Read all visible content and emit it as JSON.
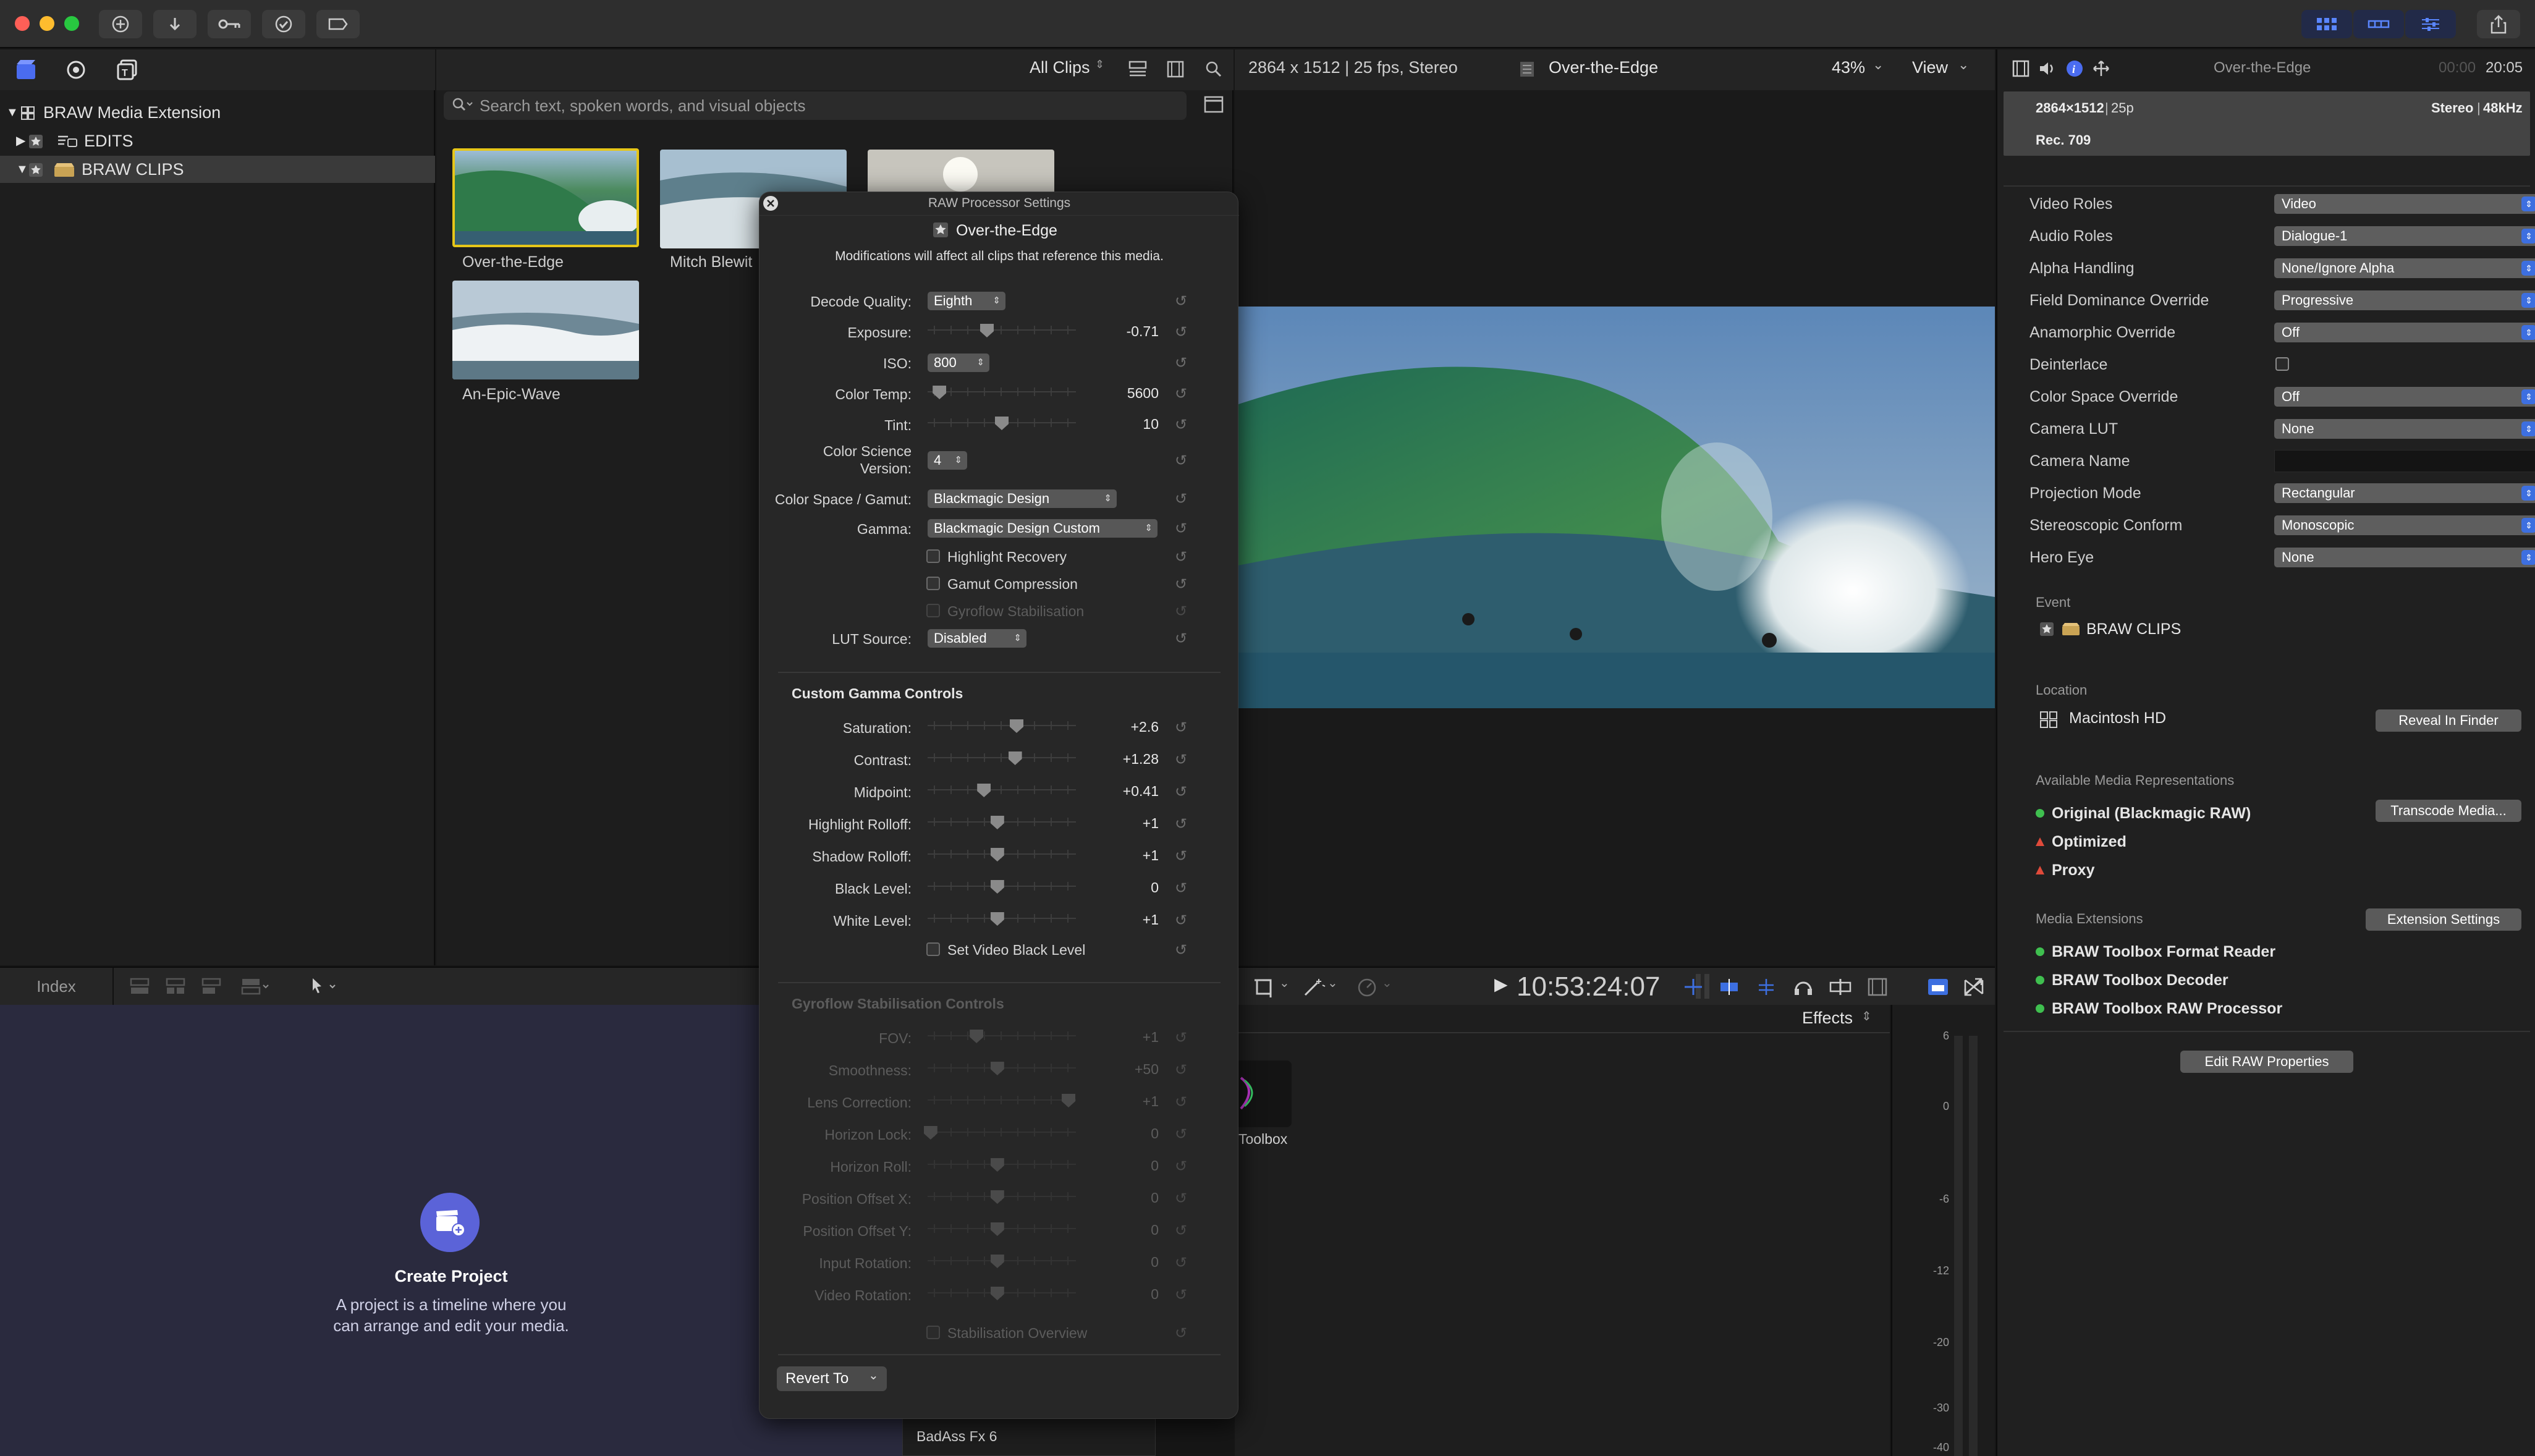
{
  "titlebar": {
    "buttons": [
      "import-icon",
      "download-icon",
      "key-icon",
      "checkmark-icon",
      "badge-icon"
    ],
    "view_buttons": [
      "grid-icon",
      "timeline-icon",
      "sliders-icon"
    ]
  },
  "library": {
    "items": [
      {
        "label": "BRAW Media Extension"
      },
      {
        "label": "EDITS"
      },
      {
        "label": "BRAW CLIPS"
      }
    ]
  },
  "browser": {
    "filter": "All Clips",
    "search_placeholder": "Search text, spoken words, and visual objects",
    "clips": [
      {
        "label": "Over-the-Edge"
      },
      {
        "label": "Mitch Blewit"
      },
      {
        "label": "An-Epic-Wave"
      }
    ]
  },
  "viewer": {
    "format": "2864 x 1512 | 25 fps, Stereo",
    "clip_name": "Over-the-Edge",
    "zoom": "43%",
    "view_label": "View",
    "timecode": "10:53:24:07"
  },
  "inspector": {
    "clip_name": "Over-the-Edge",
    "duration": "00:00",
    "timecode": "20:05",
    "resolution": "2864×1512",
    "frame_rate": "25p",
    "audio": "Stereo",
    "sample_rate": "48kHz",
    "color_space": "Rec. 709",
    "settings": [
      {
        "label": "Video Roles",
        "value": "Video"
      },
      {
        "label": "Audio Roles",
        "value": "Dialogue-1"
      },
      {
        "label": "Alpha Handling",
        "value": "None/Ignore Alpha"
      },
      {
        "label": "Field Dominance Override",
        "value": "Progressive"
      },
      {
        "label": "Anamorphic Override",
        "value": "Off"
      },
      {
        "label": "Deinterlace",
        "value": ""
      },
      {
        "label": "Color Space Override",
        "value": "Off"
      },
      {
        "label": "Camera LUT",
        "value": "None"
      },
      {
        "label": "Camera Name",
        "value": ""
      },
      {
        "label": "Projection Mode",
        "value": "Rectangular"
      },
      {
        "label": "Stereoscopic Conform",
        "value": "Monoscopic"
      },
      {
        "label": "Hero Eye",
        "value": "None"
      }
    ],
    "event_heading": "Event",
    "event_value": "BRAW CLIPS",
    "location_heading": "Location",
    "location_value": "Macintosh HD",
    "reveal_button": "Reveal In Finder",
    "representations_heading": "Available Media Representations",
    "representations": [
      {
        "label": "Original (Blackmagic RAW)",
        "status_color": "#3fbf4f"
      },
      {
        "label": "Optimized",
        "status_color": "#e04a3a"
      },
      {
        "label": "Proxy",
        "status_color": "#e04a3a"
      }
    ],
    "transcode_button": "Transcode Media...",
    "extensions_heading": "Media Extensions",
    "extension_settings_button": "Extension Settings",
    "extensions": [
      {
        "label": "BRAW Toolbox Format Reader"
      },
      {
        "label": "BRAW Toolbox Decoder"
      },
      {
        "label": "BRAW Toolbox RAW Processor"
      }
    ],
    "edit_raw_button": "Edit RAW Properties"
  },
  "timeline": {
    "index_label": "Index",
    "create_title": "Create Project",
    "create_desc_1": "A project is a timeline where you",
    "create_desc_2": "can arrange and edit your media."
  },
  "effects": {
    "label": "Effects",
    "item_label": "Toolbox",
    "footer_item": "BadAss Fx 6",
    "meter_ticks": [
      "6",
      "0",
      "-6",
      "-12",
      "-20",
      "-30",
      "-40"
    ]
  },
  "raw_panel": {
    "title": "RAW Processor Settings",
    "clip_name": "Over-the-Edge",
    "note": "Modifications will affect all clips that reference this media.",
    "decode_quality": {
      "label": "Decode Quality:",
      "value": "Eighth"
    },
    "exposure": {
      "label": "Exposure:",
      "value": "-0.71",
      "pos": 0.4
    },
    "iso": {
      "label": "ISO:",
      "value": "800"
    },
    "color_temp": {
      "label": "Color Temp:",
      "value": "5600",
      "pos": 0.08
    },
    "tint": {
      "label": "Tint:",
      "value": "10",
      "pos": 0.5
    },
    "csv_label_1": "Color Science",
    "csv_label_2": "Version:",
    "color_science_version": "4",
    "color_space": {
      "label": "Color Space / Gamut:",
      "value": "Blackmagic Design"
    },
    "gamma": {
      "label": "Gamma:",
      "value": "Blackmagic Design Custom"
    },
    "checkbox_highlight": "Highlight Recovery",
    "checkbox_gamut": "Gamut Compression",
    "checkbox_gyroflow": "Gyroflow Stabilisation",
    "lut_source": {
      "label": "LUT Source:",
      "value": "Disabled"
    },
    "custom_gamma_heading": "Custom Gamma Controls",
    "gamma_controls": [
      {
        "label": "Saturation:",
        "value": "+2.6",
        "pos": 0.6
      },
      {
        "label": "Contrast:",
        "value": "+1.28",
        "pos": 0.59
      },
      {
        "label": "Midpoint:",
        "value": "+0.41",
        "pos": 0.38
      },
      {
        "label": "Highlight Rolloff:",
        "value": "+1",
        "pos": 0.47
      },
      {
        "label": "Shadow Rolloff:",
        "value": "+1",
        "pos": 0.47
      },
      {
        "label": "Black Level:",
        "value": "0",
        "pos": 0.47
      },
      {
        "label": "White Level:",
        "value": "+1",
        "pos": 0.47
      }
    ],
    "checkbox_video_black": "Set Video Black Level",
    "gyroflow_heading": "Gyroflow Stabilisation Controls",
    "gyroflow_controls": [
      {
        "label": "FOV:",
        "value": "+1",
        "pos": 0.33
      },
      {
        "label": "Smoothness:",
        "value": "+50",
        "pos": 0.47
      },
      {
        "label": "Lens Correction:",
        "value": "+1",
        "pos": 0.95
      },
      {
        "label": "Horizon Lock:",
        "value": "0",
        "pos": 0.02
      },
      {
        "label": "Horizon Roll:",
        "value": "0",
        "pos": 0.47
      },
      {
        "label": "Position Offset X:",
        "value": "0",
        "pos": 0.47
      },
      {
        "label": "Position Offset Y:",
        "value": "0",
        "pos": 0.47
      },
      {
        "label": "Input Rotation:",
        "value": "0",
        "pos": 0.47
      },
      {
        "label": "Video Rotation:",
        "value": "0",
        "pos": 0.47
      }
    ],
    "checkbox_stab_overview": "Stabilisation Overview",
    "revert_button": "Revert To"
  },
  "colors": {
    "accent": "#3d6fe0",
    "selection": "#e6c619",
    "timeline_bg": "#2a2a3e"
  }
}
